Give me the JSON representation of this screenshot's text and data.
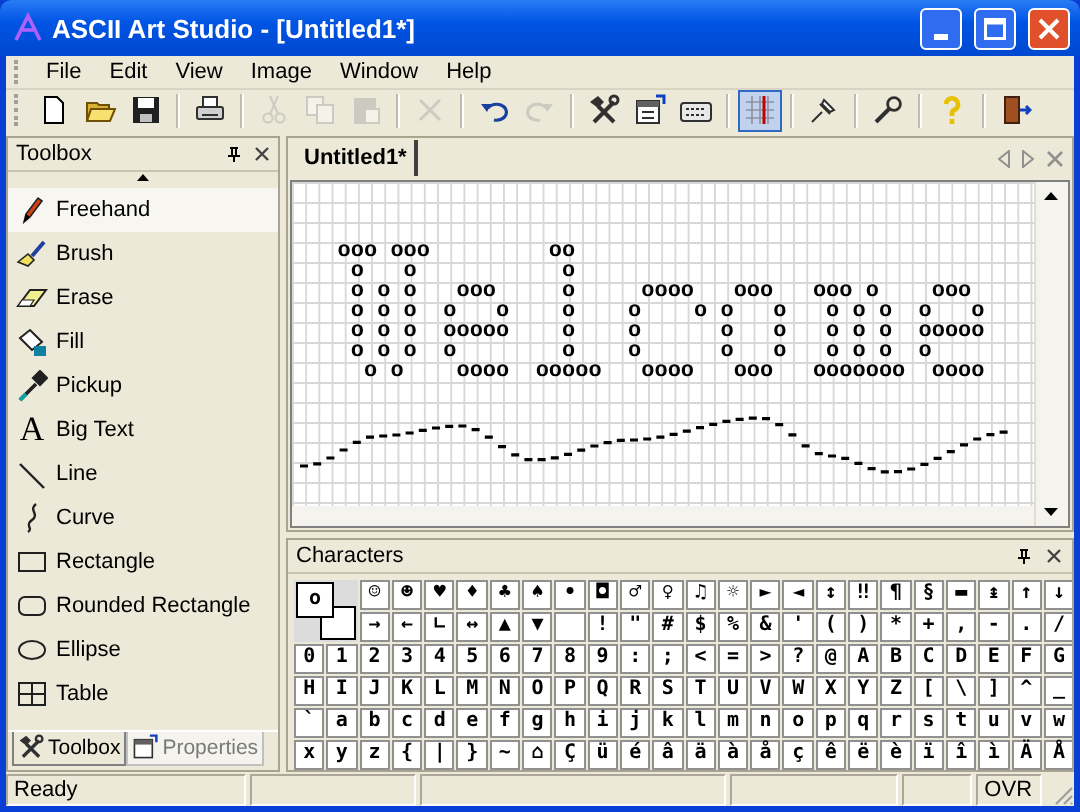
{
  "window": {
    "title": "ASCII Art Studio - [Untitled1*]"
  },
  "menu": [
    "File",
    "Edit",
    "View",
    "Image",
    "Window",
    "Help"
  ],
  "toolbar": [
    {
      "kind": "new",
      "disabled": false,
      "on": false
    },
    {
      "kind": "open",
      "disabled": false,
      "on": false
    },
    {
      "kind": "save",
      "disabled": false,
      "on": false
    },
    {
      "kind": "separator"
    },
    {
      "kind": "print",
      "disabled": false,
      "on": false
    },
    {
      "kind": "separator"
    },
    {
      "kind": "cut",
      "disabled": true,
      "on": false
    },
    {
      "kind": "copy",
      "disabled": true,
      "on": false
    },
    {
      "kind": "paste",
      "disabled": true,
      "on": false
    },
    {
      "kind": "separator"
    },
    {
      "kind": "delete",
      "disabled": true,
      "on": false
    },
    {
      "kind": "separator"
    },
    {
      "kind": "undo",
      "disabled": false,
      "on": false
    },
    {
      "kind": "redo",
      "disabled": true,
      "on": false
    },
    {
      "kind": "separator"
    },
    {
      "kind": "tools",
      "disabled": false,
      "on": false
    },
    {
      "kind": "properties",
      "disabled": false,
      "on": false
    },
    {
      "kind": "keyboard",
      "disabled": false,
      "on": false
    },
    {
      "kind": "separator"
    },
    {
      "kind": "grid",
      "disabled": false,
      "on": true
    },
    {
      "kind": "separator"
    },
    {
      "kind": "pin",
      "disabled": false,
      "on": false
    },
    {
      "kind": "separator"
    },
    {
      "kind": "wrench",
      "disabled": false,
      "on": false
    },
    {
      "kind": "separator"
    },
    {
      "kind": "help",
      "disabled": false,
      "on": false
    },
    {
      "kind": "separator"
    },
    {
      "kind": "exit",
      "disabled": false,
      "on": false
    }
  ],
  "toolbox": {
    "title": "Toolbox",
    "items": [
      {
        "label": "Freehand",
        "kind": "freehand",
        "selected": true
      },
      {
        "label": "Brush",
        "kind": "brush",
        "selected": false
      },
      {
        "label": "Erase",
        "kind": "erase",
        "selected": false
      },
      {
        "label": "Fill",
        "kind": "fill",
        "selected": false
      },
      {
        "label": "Pickup",
        "kind": "pickup",
        "selected": false
      },
      {
        "label": "Big Text",
        "kind": "bigtext",
        "glyph": "A",
        "selected": false
      },
      {
        "label": "Line",
        "kind": "line",
        "selected": false
      },
      {
        "label": "Curve",
        "kind": "curve",
        "selected": false
      },
      {
        "label": "Rectangle",
        "kind": "rectangle",
        "selected": false
      },
      {
        "label": "Rounded Rectangle",
        "kind": "roundrect",
        "selected": false
      },
      {
        "label": "Ellipse",
        "kind": "ellipse",
        "selected": false
      },
      {
        "label": "Table",
        "kind": "table",
        "selected": false
      }
    ],
    "tabs": [
      {
        "label": "Toolbox",
        "kind": "tools",
        "selected": true
      },
      {
        "label": "Properties",
        "kind": "properties",
        "selected": false
      }
    ]
  },
  "document": {
    "tabs": [
      {
        "label": "Untitled1*",
        "selected": true
      }
    ],
    "art_lines": [
      "   ooo ooo         oo",
      "    o   o           o",
      "    o o o   ooo     o     oooo   ooo   ooo o    ooo",
      "    o o o  o   o    o    o    o o   o   o o o  o   o",
      "    o o o  ooooo    o    o      o   o   o o o  ooooo",
      "    o o o  o        o    o      o   o   o o o  o",
      "     o o    oooo  ooooo   oooo   ooo   ooooooo  oooo"
    ]
  },
  "characters": {
    "title": "Characters",
    "preview": "o",
    "symbol_rows": [
      [
        "☺",
        "☻",
        "♥",
        "♦",
        "♣",
        "♠",
        "•",
        "◘",
        "♂",
        "♀",
        "♫",
        "☼",
        "►",
        "◄",
        "↕",
        "‼",
        "¶",
        "§",
        "▬",
        "↨",
        "↑",
        "↓"
      ],
      [
        "→",
        "←",
        "∟",
        "↔",
        "▲",
        "▼",
        " ",
        "!",
        "\"",
        "#",
        "$",
        "%",
        "&",
        "'",
        "(",
        ")",
        "*",
        "+",
        ",",
        "-",
        ".",
        "/"
      ]
    ],
    "rows": [
      [
        "0",
        "1",
        "2",
        "3",
        "4",
        "5",
        "6",
        "7",
        "8",
        "9",
        ":",
        ";",
        "<",
        "=",
        ">",
        "?",
        "@",
        "A",
        "B",
        "C",
        "D",
        "E",
        "F",
        "G"
      ],
      [
        "H",
        "I",
        "J",
        "K",
        "L",
        "M",
        "N",
        "O",
        "P",
        "Q",
        "R",
        "S",
        "T",
        "U",
        "V",
        "W",
        "X",
        "Y",
        "Z",
        "[",
        "\\",
        "]",
        "^",
        "_"
      ],
      [
        "`",
        "a",
        "b",
        "c",
        "d",
        "e",
        "f",
        "g",
        "h",
        "i",
        "j",
        "k",
        "l",
        "m",
        "n",
        "o",
        "p",
        "q",
        "r",
        "s",
        "t",
        "u",
        "v",
        "w"
      ],
      [
        "x",
        "y",
        "z",
        "{",
        "|",
        "}",
        "~",
        "⌂",
        "Ç",
        "ü",
        "é",
        "â",
        "ä",
        "à",
        "å",
        "ç",
        "ê",
        "ë",
        "è",
        "ï",
        "î",
        "ì",
        "Ä",
        "Å"
      ]
    ]
  },
  "status_bar": {
    "message": "Ready",
    "mode": "OVR"
  }
}
